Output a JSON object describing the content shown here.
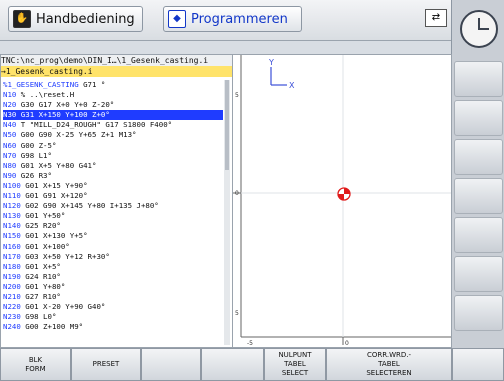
{
  "header": {
    "mode_manual": "Handbediening",
    "mode_program": "Programmeren"
  },
  "editor": {
    "path": "TNC:\\nc_prog\\demo\\DIN_I…\\1_Gesenk_casting.i",
    "file": "→1_Gesenk_casting.i",
    "lines": [
      {
        "n": "%1_GESENK_CASTING",
        "r": " G71 °"
      },
      {
        "n": "N10",
        "r": " % ..\\reset.H"
      },
      {
        "n": "N20",
        "r": " G30 G17 X+0 Y+0 Z-20°"
      },
      {
        "n": "N30",
        "r": " G31 X+150 Y+100 Z+0°",
        "sel": true
      },
      {
        "n": "N40",
        "r": " T \"MILL_D24_ROUGH\" G17 S1800 F400°"
      },
      {
        "n": "N50",
        "r": " G00 G90 X-25 Y+65 Z+1 M13°"
      },
      {
        "n": "N60",
        "r": " G00 Z-5°"
      },
      {
        "n": "N70",
        "r": " G98 L1°"
      },
      {
        "n": "N80",
        "r": " G01 X+5 Y+80 G41°"
      },
      {
        "n": "N90",
        "r": " G26 R3°"
      },
      {
        "n": "N100",
        "r": " G01 X+15 Y+90°"
      },
      {
        "n": "N110",
        "r": " G01 G91 X+120°"
      },
      {
        "n": "N120",
        "r": " G02 G90 X+145 Y+80 I+135 J+80°"
      },
      {
        "n": "N130",
        "r": " G01 Y+50°"
      },
      {
        "n": "N140",
        "r": " G25 R20°"
      },
      {
        "n": "N150",
        "r": " G01 X+130 Y+5°"
      },
      {
        "n": "N160",
        "r": " G01 X+100°"
      },
      {
        "n": "N170",
        "r": " G03 X+50 Y+12 R+30°"
      },
      {
        "n": "N180",
        "r": " G01 X+5°"
      },
      {
        "n": "N190",
        "r": " G24 R10°"
      },
      {
        "n": "N200",
        "r": " G01 Y+80°"
      },
      {
        "n": "N210",
        "r": " G27 R10°"
      },
      {
        "n": "N220",
        "r": " G01 X-20 Y+90 G40°"
      },
      {
        "n": "N230",
        "r": " G98 L0°"
      },
      {
        "n": "N240",
        "r": " G00 Z+100 M9°"
      }
    ]
  },
  "graphics": {
    "left_ruler_labels": [
      "5",
      "0",
      "5"
    ],
    "bottom_ruler_labels": [
      "-5",
      "0"
    ],
    "axis_x": "X",
    "axis_y": "Y"
  },
  "softkeys": [
    {
      "label": "BLK\nFORM"
    },
    {
      "label": "PRESET"
    },
    {
      "label": ""
    },
    {
      "label": ""
    },
    {
      "label": "NULPUNT\nTABEL\nSELECT"
    },
    {
      "label": "CORR.WRD.-\nTABEL\nSELECTEREN"
    },
    {
      "label": ""
    }
  ]
}
